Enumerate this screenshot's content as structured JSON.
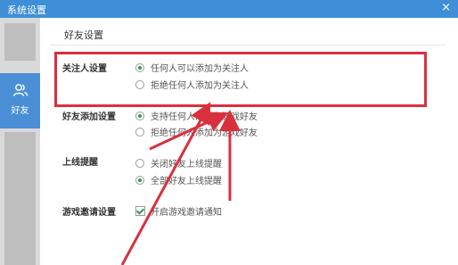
{
  "window": {
    "title": "系统设置",
    "close_glyph": "×"
  },
  "sidebar": {
    "friend_label": "好友"
  },
  "section": {
    "title": "好友设置"
  },
  "groups": [
    {
      "label": "关注人设置",
      "options": [
        "任何人可以添加为关注人",
        "拒绝任何人添加为关注人"
      ],
      "selected": 0
    },
    {
      "label": "好友添加设置",
      "options": [
        "支持任何人添加为游戏好友",
        "拒绝任何人添加为游戏好友"
      ],
      "selected": 0
    },
    {
      "label": "上线提醒",
      "options": [
        "关闭好友上线提醒",
        "全部好友上线提醒"
      ],
      "selected": 1
    },
    {
      "label": "游戏邀请设置",
      "options": [
        "开启游戏邀请通知"
      ],
      "checked": true
    }
  ],
  "annotation": {
    "color": "#d9303e"
  },
  "colors": {
    "titlebar": "#3f8fd8",
    "sidebar_active": "#4a8fd6",
    "radio_on": "#2e9b4f"
  }
}
